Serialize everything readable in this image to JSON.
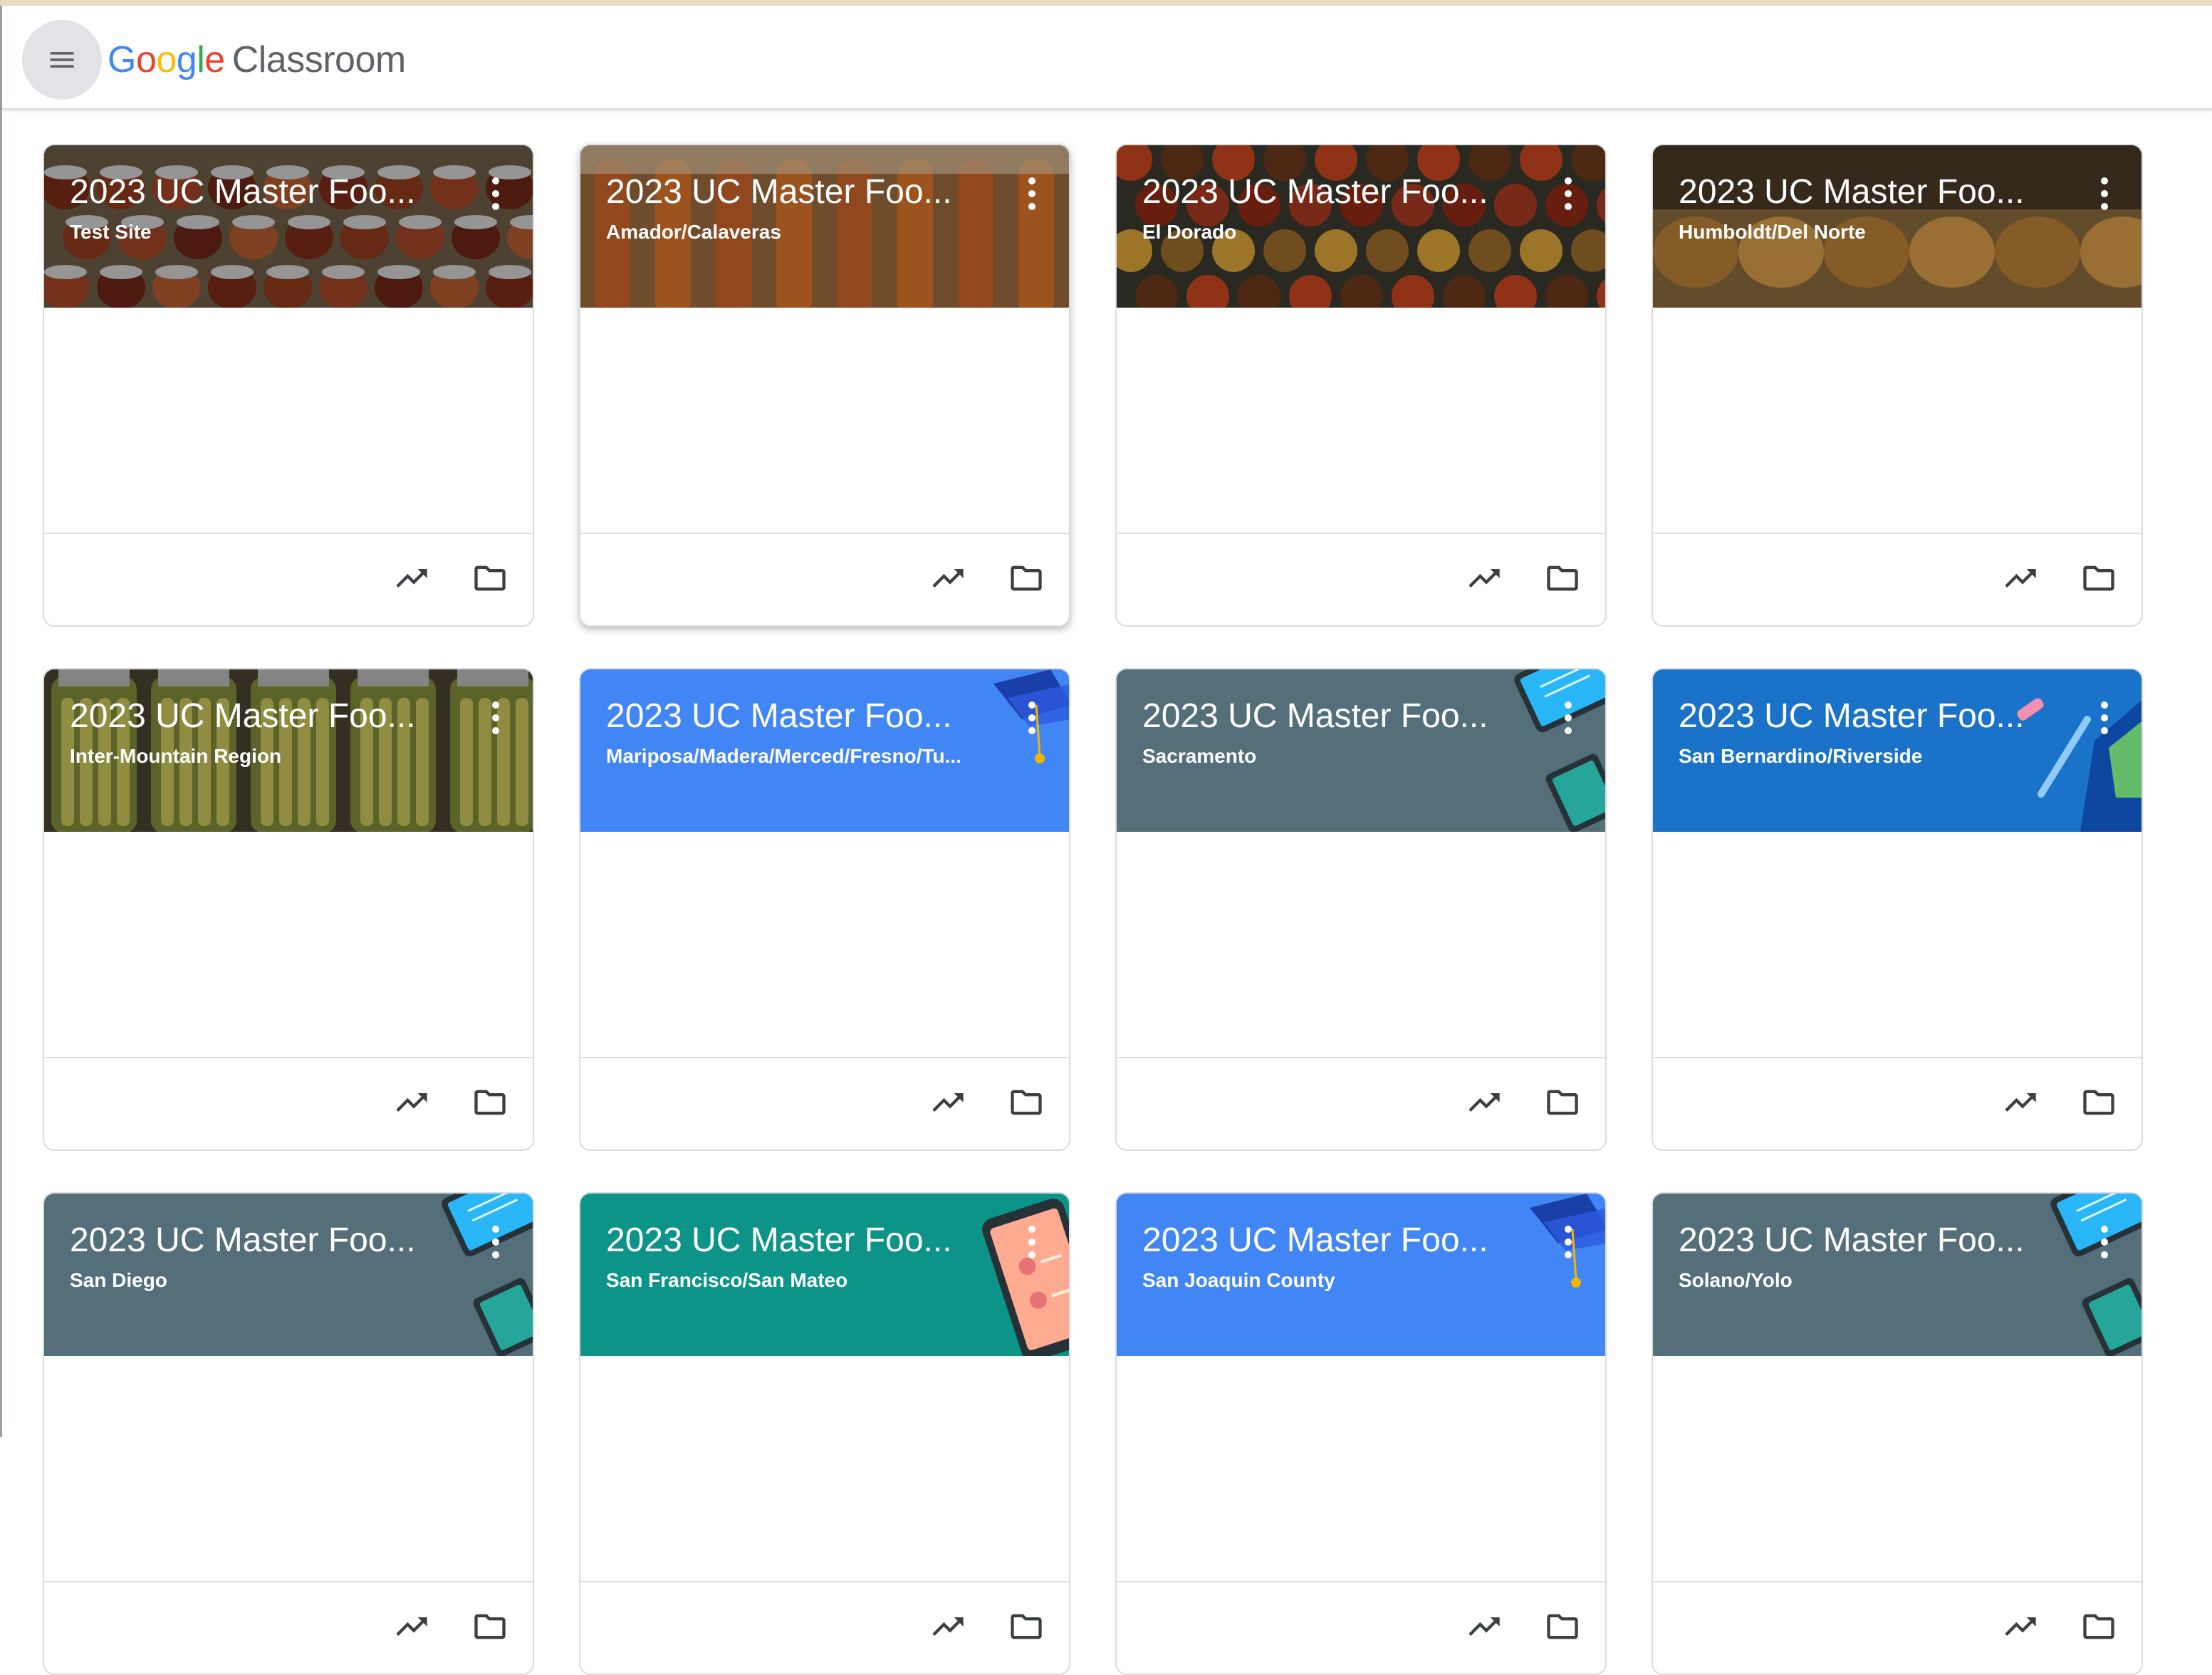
{
  "header": {
    "logo_google": "Google",
    "logo_product": "Classroom",
    "brand_colors": {
      "blue": "#4285f4",
      "red": "#ea4335",
      "yellow": "#fbbc05",
      "green": "#34a853"
    }
  },
  "cards": [
    {
      "title": "2023 UC Master Foo...",
      "subtitle": "Test Site",
      "theme": "photo-jars"
    },
    {
      "title": "2023 UC Master Foo...",
      "subtitle": "Amador/Calaveras",
      "theme": "photo-carrots"
    },
    {
      "title": "2023 UC Master Foo...",
      "subtitle": "El Dorado",
      "theme": "photo-tomatoes"
    },
    {
      "title": "2023 UC Master Foo...",
      "subtitle": "Humboldt/Del Norte",
      "theme": "photo-pickles"
    },
    {
      "title": "2023 UC Master Foo...",
      "subtitle": "Inter-Mountain Region",
      "theme": "photo-pickle-jars"
    },
    {
      "title": "2023 UC Master Foo...",
      "subtitle": "Mariposa/Madera/Merced/Fresno/Tu...",
      "theme": "blue-graduation"
    },
    {
      "title": "2023 UC Master Foo...",
      "subtitle": "Sacramento",
      "theme": "slate-devices"
    },
    {
      "title": "2023 UC Master Foo...",
      "subtitle": "San Bernardino/Riverside",
      "theme": "deep-blue-stationery"
    },
    {
      "title": "2023 UC Master Foo...",
      "subtitle": "San Diego",
      "theme": "slate-devices"
    },
    {
      "title": "2023 UC Master Foo...",
      "subtitle": "San Francisco/San Mateo",
      "theme": "teal-phone"
    },
    {
      "title": "2023 UC Master Foo...",
      "subtitle": "San Joaquin County",
      "theme": "blue-graduation"
    },
    {
      "title": "2023 UC Master Foo...",
      "subtitle": "Solano/Yolo",
      "theme": "slate-devices"
    }
  ],
  "icons": {
    "menu": "hamburger-menu-icon",
    "more": "more-vert-icon",
    "trend": "trending-up-icon",
    "folder": "folder-icon"
  },
  "theme_colors": {
    "blue": "#4285f4",
    "slate": "#546e7a",
    "deep_blue": "#1a73c8",
    "teal": "#0d9488"
  }
}
